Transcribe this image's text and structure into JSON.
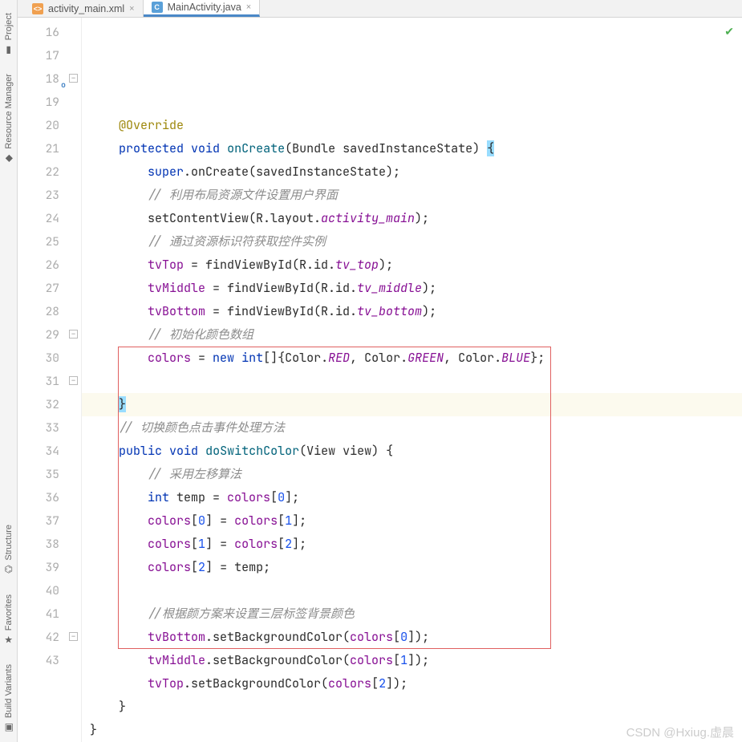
{
  "sidebar": {
    "items": [
      {
        "label": "Project",
        "icon": "▮"
      },
      {
        "label": "Resource Manager",
        "icon": "◆"
      },
      {
        "label": "Structure",
        "icon": "⌬"
      },
      {
        "label": "Favorites",
        "icon": "★"
      },
      {
        "label": "Build Variants",
        "icon": "▣"
      }
    ]
  },
  "tabs": [
    {
      "label": "activity_main.xml",
      "icon": "xml",
      "active": false
    },
    {
      "label": "MainActivity.java",
      "icon": "java",
      "active": true
    }
  ],
  "watermark": "CSDN @Hxiug.虚晨",
  "lines": [
    {
      "n": "16",
      "tok": []
    },
    {
      "n": "17",
      "tok": [
        {
          "t": "    ",
          "c": ""
        },
        {
          "t": "@Override",
          "c": "ann"
        }
      ]
    },
    {
      "n": "18",
      "ov": "o↑",
      "tok": [
        {
          "t": "    ",
          "c": ""
        },
        {
          "t": "protected",
          "c": "kw"
        },
        {
          "t": " ",
          "c": ""
        },
        {
          "t": "void",
          "c": "kw"
        },
        {
          "t": " ",
          "c": ""
        },
        {
          "t": "onCreate",
          "c": "fn"
        },
        {
          "t": "(Bundle savedInstanceState) ",
          "c": ""
        },
        {
          "t": "{",
          "c": "brace-hl"
        }
      ]
    },
    {
      "n": "19",
      "tok": [
        {
          "t": "        ",
          "c": ""
        },
        {
          "t": "super",
          "c": "kw"
        },
        {
          "t": ".onCreate(savedInstanceState);",
          "c": ""
        }
      ]
    },
    {
      "n": "20",
      "tok": [
        {
          "t": "        ",
          "c": ""
        },
        {
          "t": "// 利用布局资源文件设置用户界面",
          "c": "cmt"
        }
      ]
    },
    {
      "n": "21",
      "tok": [
        {
          "t": "        setContentView(R.layout.",
          "c": ""
        },
        {
          "t": "activity_main",
          "c": "id"
        },
        {
          "t": ");",
          "c": ""
        }
      ]
    },
    {
      "n": "22",
      "tok": [
        {
          "t": "        ",
          "c": ""
        },
        {
          "t": "// 通过资源标识符获取控件实例",
          "c": "cmt"
        }
      ]
    },
    {
      "n": "23",
      "tok": [
        {
          "t": "        ",
          "c": ""
        },
        {
          "t": "tvTop",
          "c": "idp"
        },
        {
          "t": " = findViewById(R.id.",
          "c": ""
        },
        {
          "t": "tv_top",
          "c": "id"
        },
        {
          "t": ");",
          "c": ""
        }
      ]
    },
    {
      "n": "24",
      "tok": [
        {
          "t": "        ",
          "c": ""
        },
        {
          "t": "tvMiddle",
          "c": "idp"
        },
        {
          "t": " = findViewById(R.id.",
          "c": ""
        },
        {
          "t": "tv_middle",
          "c": "id"
        },
        {
          "t": ");",
          "c": ""
        }
      ]
    },
    {
      "n": "25",
      "tok": [
        {
          "t": "        ",
          "c": ""
        },
        {
          "t": "tvBottom",
          "c": "idp"
        },
        {
          "t": " = findViewById(R.id.",
          "c": ""
        },
        {
          "t": "tv_bottom",
          "c": "id"
        },
        {
          "t": ");",
          "c": ""
        }
      ]
    },
    {
      "n": "26",
      "tok": [
        {
          "t": "        ",
          "c": ""
        },
        {
          "t": "// 初始化颜色数组",
          "c": "cmt"
        }
      ]
    },
    {
      "n": "27",
      "tok": [
        {
          "t": "        ",
          "c": ""
        },
        {
          "t": "colors",
          "c": "idp"
        },
        {
          "t": " = ",
          "c": ""
        },
        {
          "t": "new",
          "c": "kw"
        },
        {
          "t": " ",
          "c": ""
        },
        {
          "t": "int",
          "c": "kw"
        },
        {
          "t": "[]{Color.",
          "c": ""
        },
        {
          "t": "RED",
          "c": "id"
        },
        {
          "t": ", Color.",
          "c": ""
        },
        {
          "t": "GREEN",
          "c": "id"
        },
        {
          "t": ", Color.",
          "c": ""
        },
        {
          "t": "BLUE",
          "c": "id"
        },
        {
          "t": "};",
          "c": ""
        }
      ]
    },
    {
      "n": "28",
      "tok": []
    },
    {
      "n": "29",
      "hl": true,
      "tok": [
        {
          "t": "    ",
          "c": ""
        },
        {
          "t": "}",
          "c": "brace-hl"
        }
      ]
    },
    {
      "n": "30",
      "tok": [
        {
          "t": "    ",
          "c": ""
        },
        {
          "t": "// 切换颜色点击事件处理方法",
          "c": "cmt"
        }
      ]
    },
    {
      "n": "31",
      "tok": [
        {
          "t": "    ",
          "c": ""
        },
        {
          "t": "public",
          "c": "kw"
        },
        {
          "t": " ",
          "c": ""
        },
        {
          "t": "void",
          "c": "kw"
        },
        {
          "t": " ",
          "c": ""
        },
        {
          "t": "doSwitchColor",
          "c": "fn"
        },
        {
          "t": "(View view) {",
          "c": ""
        }
      ]
    },
    {
      "n": "32",
      "tok": [
        {
          "t": "        ",
          "c": ""
        },
        {
          "t": "// 采用左移算法",
          "c": "cmt"
        }
      ]
    },
    {
      "n": "33",
      "tok": [
        {
          "t": "        ",
          "c": ""
        },
        {
          "t": "int",
          "c": "kw"
        },
        {
          "t": " temp = ",
          "c": ""
        },
        {
          "t": "colors",
          "c": "idp"
        },
        {
          "t": "[",
          "c": ""
        },
        {
          "t": "0",
          "c": "num"
        },
        {
          "t": "];",
          "c": ""
        }
      ]
    },
    {
      "n": "34",
      "tok": [
        {
          "t": "        ",
          "c": ""
        },
        {
          "t": "colors",
          "c": "idp"
        },
        {
          "t": "[",
          "c": ""
        },
        {
          "t": "0",
          "c": "num"
        },
        {
          "t": "] = ",
          "c": ""
        },
        {
          "t": "colors",
          "c": "idp"
        },
        {
          "t": "[",
          "c": ""
        },
        {
          "t": "1",
          "c": "num"
        },
        {
          "t": "];",
          "c": ""
        }
      ]
    },
    {
      "n": "35",
      "tok": [
        {
          "t": "        ",
          "c": ""
        },
        {
          "t": "colors",
          "c": "idp"
        },
        {
          "t": "[",
          "c": ""
        },
        {
          "t": "1",
          "c": "num"
        },
        {
          "t": "] = ",
          "c": ""
        },
        {
          "t": "colors",
          "c": "idp"
        },
        {
          "t": "[",
          "c": ""
        },
        {
          "t": "2",
          "c": "num"
        },
        {
          "t": "];",
          "c": ""
        }
      ]
    },
    {
      "n": "36",
      "tok": [
        {
          "t": "        ",
          "c": ""
        },
        {
          "t": "colors",
          "c": "idp"
        },
        {
          "t": "[",
          "c": ""
        },
        {
          "t": "2",
          "c": "num"
        },
        {
          "t": "] = temp;",
          "c": ""
        }
      ]
    },
    {
      "n": "37",
      "tok": []
    },
    {
      "n": "38",
      "tok": [
        {
          "t": "        ",
          "c": ""
        },
        {
          "t": "//根据颜方案来设置三层标签背景颜色",
          "c": "cmt"
        }
      ]
    },
    {
      "n": "39",
      "tok": [
        {
          "t": "        ",
          "c": ""
        },
        {
          "t": "tvBottom",
          "c": "idp"
        },
        {
          "t": ".setBackgroundColor(",
          "c": ""
        },
        {
          "t": "colors",
          "c": "idp"
        },
        {
          "t": "[",
          "c": ""
        },
        {
          "t": "0",
          "c": "num"
        },
        {
          "t": "]);",
          "c": ""
        }
      ]
    },
    {
      "n": "40",
      "tok": [
        {
          "t": "        ",
          "c": ""
        },
        {
          "t": "tvMiddle",
          "c": "idp"
        },
        {
          "t": ".setBackgroundColor(",
          "c": ""
        },
        {
          "t": "colors",
          "c": "idp"
        },
        {
          "t": "[",
          "c": ""
        },
        {
          "t": "1",
          "c": "num"
        },
        {
          "t": "]);",
          "c": ""
        }
      ]
    },
    {
      "n": "41",
      "tok": [
        {
          "t": "        ",
          "c": ""
        },
        {
          "t": "tvTop",
          "c": "idp"
        },
        {
          "t": ".setBackgroundColor(",
          "c": ""
        },
        {
          "t": "colors",
          "c": "idp"
        },
        {
          "t": "[",
          "c": ""
        },
        {
          "t": "2",
          "c": "num"
        },
        {
          "t": "]);",
          "c": ""
        }
      ]
    },
    {
      "n": "42",
      "tok": [
        {
          "t": "    }",
          "c": ""
        }
      ]
    },
    {
      "n": "43",
      "tok": [
        {
          "t": "}",
          "c": ""
        }
      ]
    }
  ]
}
